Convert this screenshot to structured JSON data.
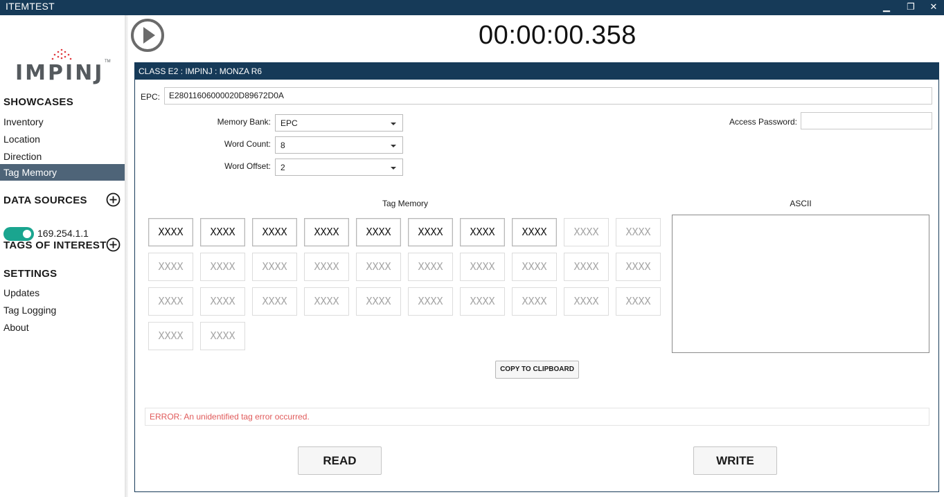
{
  "window": {
    "title": "ITEMTEST",
    "controls": {
      "minimize": "▁",
      "restore": "❐",
      "close": "✕"
    }
  },
  "brand": {
    "name": "IMPINJ",
    "tm": "TM",
    "accent_dots": "#e0393e",
    "text_color": "#555a5e"
  },
  "sidebar": {
    "showcases_title": "SHOWCASES",
    "showcases": [
      {
        "label": "Inventory",
        "active": false
      },
      {
        "label": "Location",
        "active": false
      },
      {
        "label": "Direction",
        "active": false
      },
      {
        "label": "Tag Memory",
        "active": true
      }
    ],
    "data_sources_title": "DATA SOURCES",
    "data_source": {
      "address": "169.254.1.1",
      "enabled": true,
      "toggle_color": "#1aa58f"
    },
    "tags_of_interest_title": "TAGS OF INTEREST",
    "settings_title": "SETTINGS",
    "settings": [
      {
        "label": "Updates"
      },
      {
        "label": "Tag Logging"
      },
      {
        "label": "About"
      }
    ],
    "active_color": "#4e6478"
  },
  "header": {
    "timer": "00:00:00.358",
    "play_icon": "play-circle-icon"
  },
  "panel": {
    "title": "CLASS E2 : IMPINJ : MONZA R6",
    "title_bg": "#163a58",
    "epc_label": "EPC:",
    "epc_value": "E28011606000020D89672D0A",
    "memory_bank": {
      "label": "Memory Bank:",
      "value": "EPC"
    },
    "word_count": {
      "label": "Word Count:",
      "value": "8"
    },
    "word_offset": {
      "label": "Word Offset:",
      "value": "2"
    },
    "access_password": {
      "label": "Access Password:",
      "value": ""
    },
    "tag_memory_label": "Tag Memory",
    "ascii_label": "ASCII",
    "ascii_value": "",
    "memory_words": [
      "XXXX",
      "XXXX",
      "XXXX",
      "XXXX",
      "XXXX",
      "XXXX",
      "XXXX",
      "XXXX",
      "XXXX",
      "XXXX",
      "XXXX",
      "XXXX",
      "XXXX",
      "XXXX",
      "XXXX",
      "XXXX",
      "XXXX",
      "XXXX",
      "XXXX",
      "XXXX",
      "XXXX",
      "XXXX",
      "XXXX",
      "XXXX",
      "XXXX",
      "XXXX",
      "XXXX",
      "XXXX",
      "XXXX",
      "XXXX",
      "XXXX",
      "XXXX"
    ],
    "highlighted_words": 8,
    "copy_label": "COPY TO CLIPBOARD",
    "error_text": "ERROR: An unidentified tag error occurred.",
    "error_color": "#e05a5a",
    "read_label": "READ",
    "write_label": "WRITE"
  }
}
